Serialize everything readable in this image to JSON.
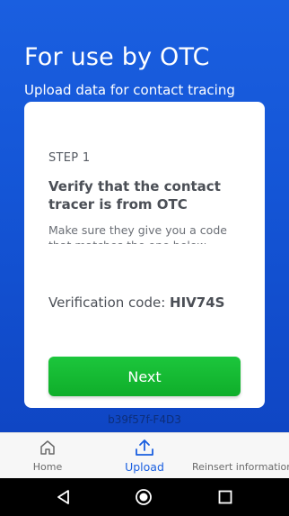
{
  "header": {
    "title": "For use by OTC",
    "subtitle": "Upload data for contact tracing"
  },
  "card": {
    "step": "STEP 1",
    "heading": "Verify that the contact tracer is from OTC",
    "description": "Make sure they give you a code that matches the one below",
    "verification_label": "Verification code:",
    "verification_code": "HIV74S",
    "next_label": "Next"
  },
  "device_hash": "b39f57f-F4D3",
  "tabs": [
    {
      "label": "Home",
      "icon": "home-icon",
      "active": false
    },
    {
      "label": "Upload",
      "icon": "upload-icon",
      "active": true
    },
    {
      "label": "Reinsert information",
      "icon": "none",
      "active": false
    }
  ],
  "colors": {
    "primary_blue": "#1a5fe0",
    "button_green": "#16bb33",
    "tab_active": "#1a5fe0"
  },
  "system_nav": [
    "back-icon",
    "home-circle-icon",
    "recents-icon"
  ]
}
